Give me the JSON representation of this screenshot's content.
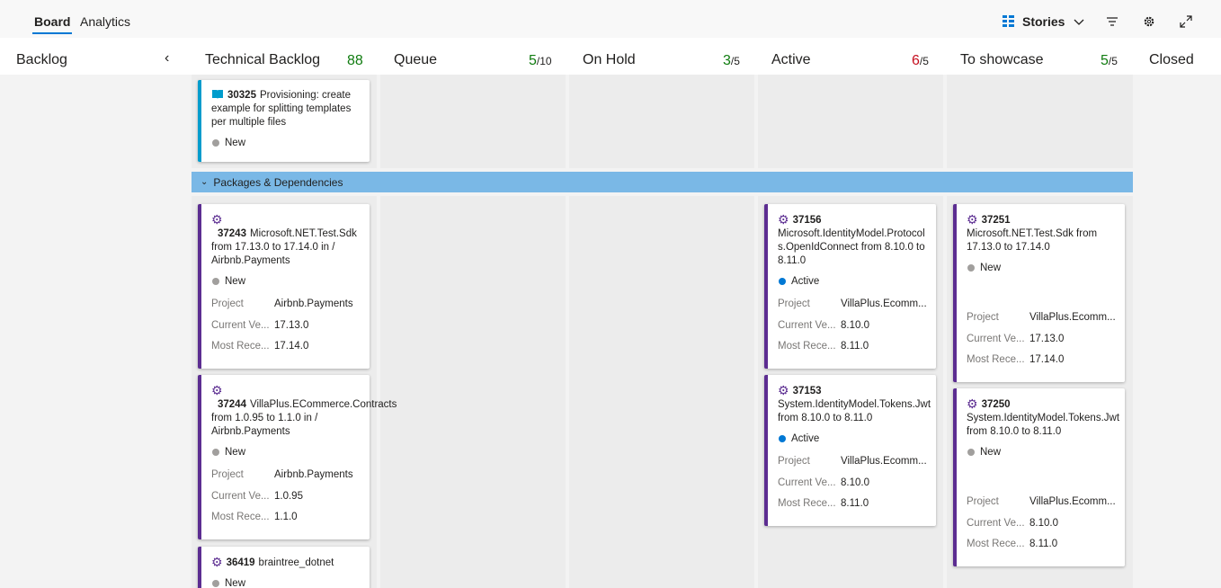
{
  "tabs": {
    "board": "Board",
    "analytics": "Analytics"
  },
  "toolbar": {
    "backlog_level": "Stories"
  },
  "columns": [
    {
      "title": "Backlog"
    },
    {
      "title": "Technical Backlog",
      "count": "88",
      "limit": ""
    },
    {
      "title": "Queue",
      "count": "5",
      "limit": "/10"
    },
    {
      "title": "On Hold",
      "count": "3",
      "limit": "/5"
    },
    {
      "title": "Active",
      "count": "6",
      "limit": "/5"
    },
    {
      "title": "To showcase",
      "count": "5",
      "limit": "/5"
    },
    {
      "title": "Closed"
    }
  ],
  "colors": {
    "accent": "#0078d4",
    "ok": "#107c10",
    "over": "#c50f1f",
    "story": "#009ccc",
    "task": "#5c2d91",
    "swimlane": "#7ab8e6"
  },
  "swimlane": {
    "label": "Packages & Dependencies"
  },
  "field_labels": {
    "project": "Project",
    "current": "Current Ve...",
    "recent": "Most Rece..."
  },
  "cards": [
    {
      "icon": "book-icon",
      "id": "30325",
      "title": "Provisioning: create example for splitting templates per multiple files",
      "state": "New"
    },
    {
      "icon": "gear-icon",
      "id": "37243",
      "title": "Microsoft.NET.Test.Sdk from 17.13.0 to 17.14.0 in / Airbnb.Payments",
      "state": "New",
      "project": "Airbnb.Payments",
      "current": "17.13.0",
      "recent": "17.14.0"
    },
    {
      "icon": "gear-icon",
      "id": "37244",
      "title": "VillaPlus.ECommerce.Contracts from 1.0.95 to 1.1.0 in / Airbnb.Payments",
      "state": "New",
      "project": "Airbnb.Payments",
      "current": "1.0.95",
      "recent": "1.1.0"
    },
    {
      "icon": "gear-icon",
      "id": "36419",
      "title": "braintree_dotnet",
      "state": "New"
    },
    {
      "icon": "gear-icon",
      "id": "37156",
      "title": "Microsoft.IdentityModel.Protocols.OpenIdConnect from 8.10.0 to 8.11.0",
      "state": "Active",
      "project": "VillaPlus.Ecomm...",
      "current": "8.10.0",
      "recent": "8.11.0"
    },
    {
      "icon": "gear-icon",
      "id": "37153",
      "title": "System.IdentityModel.Tokens.Jwt from 8.10.0 to 8.11.0",
      "state": "Active",
      "project": "VillaPlus.Ecomm...",
      "current": "8.10.0",
      "recent": "8.11.0"
    },
    {
      "icon": "gear-icon",
      "id": "37251",
      "title": "Microsoft.NET.Test.Sdk from 17.13.0 to 17.14.0",
      "state": "New",
      "project": "VillaPlus.Ecomm...",
      "current": "17.13.0",
      "recent": "17.14.0"
    },
    {
      "icon": "gear-icon",
      "id": "37250",
      "title": "System.IdentityModel.Tokens.Jwt from 8.10.0 to 8.11.0",
      "state": "New",
      "project": "VillaPlus.Ecomm...",
      "current": "8.10.0",
      "recent": "8.11.0"
    }
  ]
}
